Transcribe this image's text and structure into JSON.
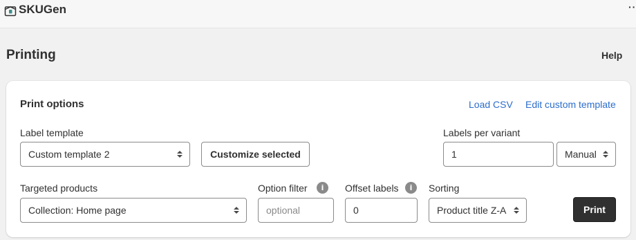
{
  "app": {
    "name": "SKUGen",
    "logo_icon": "box-icon",
    "more_icon": "more-dots-icon",
    "more_glyph": "··"
  },
  "page": {
    "title": "Printing",
    "help_label": "Help"
  },
  "print_options": {
    "title": "Print options",
    "load_csv_label": "Load CSV",
    "edit_template_label": "Edit custom template",
    "label_template": {
      "label": "Label template",
      "value": "Custom template 2"
    },
    "customize_button_label": "Customize selected",
    "labels_per_variant": {
      "label": "Labels per variant",
      "value": "1",
      "mode": "Manual"
    },
    "targeted_products": {
      "label": "Targeted products",
      "value": "Collection: Home page"
    },
    "option_filter": {
      "label": "Option filter",
      "placeholder": "optional",
      "info_icon": "info-icon"
    },
    "offset_labels": {
      "label": "Offset labels",
      "value": "0",
      "info_icon": "info-icon"
    },
    "sorting": {
      "label": "Sorting",
      "value": "Product title Z-A"
    },
    "print_button_label": "Print"
  },
  "colors": {
    "link": "#2c6ecb",
    "primary_button": "#303030",
    "background": "#f1f1f1"
  }
}
